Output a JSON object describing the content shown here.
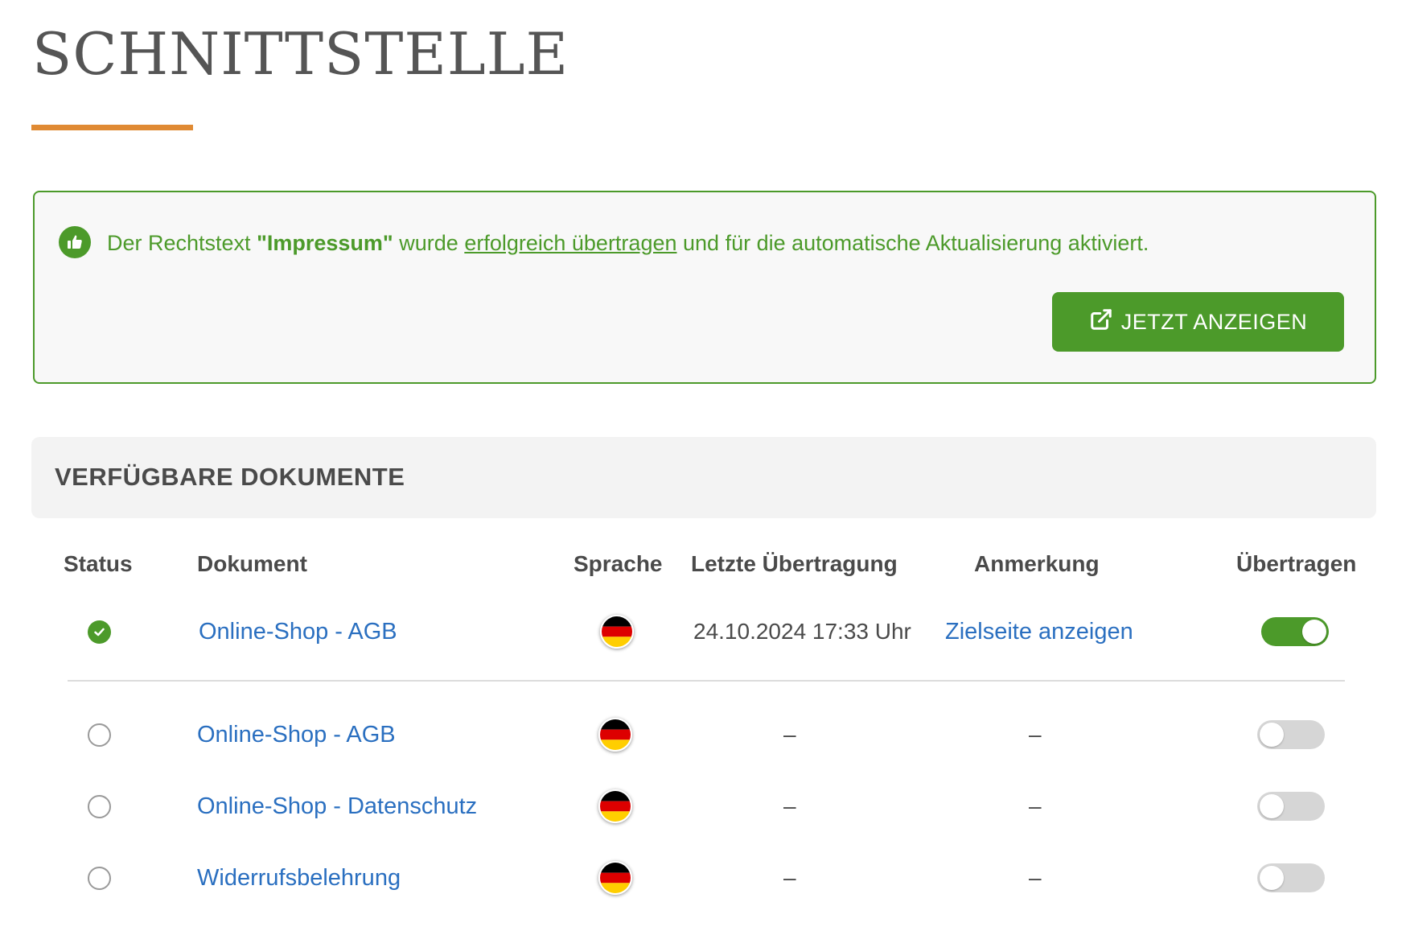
{
  "page": {
    "title": "SCHNITTSTELLE"
  },
  "notice": {
    "text_before": "Der Rechtstext",
    "document_name": "\"Impressum\"",
    "text_middle": "wurde",
    "link_text": "erfolgreich übertragen",
    "text_after": "und für die automatische Aktualisierung aktiviert.",
    "button_label": "JETZT ANZEIGEN",
    "icon": "thumbs-up-icon"
  },
  "documents": {
    "title": "VERFÜGBARE DOKUMENTE",
    "columns": {
      "status": "Status",
      "document": "Dokument",
      "language": "Sprache",
      "last_transfer": "Letzte Übertragung",
      "note": "Anmerkung",
      "transfer": "Übertragen"
    },
    "rows": [
      {
        "status": "active",
        "document": "Online-Shop - AGB",
        "language": "de",
        "last_transfer": "24.10.2024 17:33 Uhr",
        "note": "Zielseite anzeigen",
        "transfer": true
      },
      {
        "status": "inactive",
        "document": "Online-Shop - AGB",
        "language": "de",
        "last_transfer": "–",
        "note": "–",
        "transfer": false
      },
      {
        "status": "inactive",
        "document": "Online-Shop - Datenschutz",
        "language": "de",
        "last_transfer": "–",
        "note": "–",
        "transfer": false
      },
      {
        "status": "inactive",
        "document": "Widerrufsbelehrung",
        "language": "de",
        "last_transfer": "–",
        "note": "–",
        "transfer": false
      }
    ]
  },
  "colors": {
    "accent_orange": "#e08a33",
    "success_green": "#4c9a2a",
    "link_blue": "#2a6fc0",
    "toggle_off": "#d6d6d6"
  }
}
